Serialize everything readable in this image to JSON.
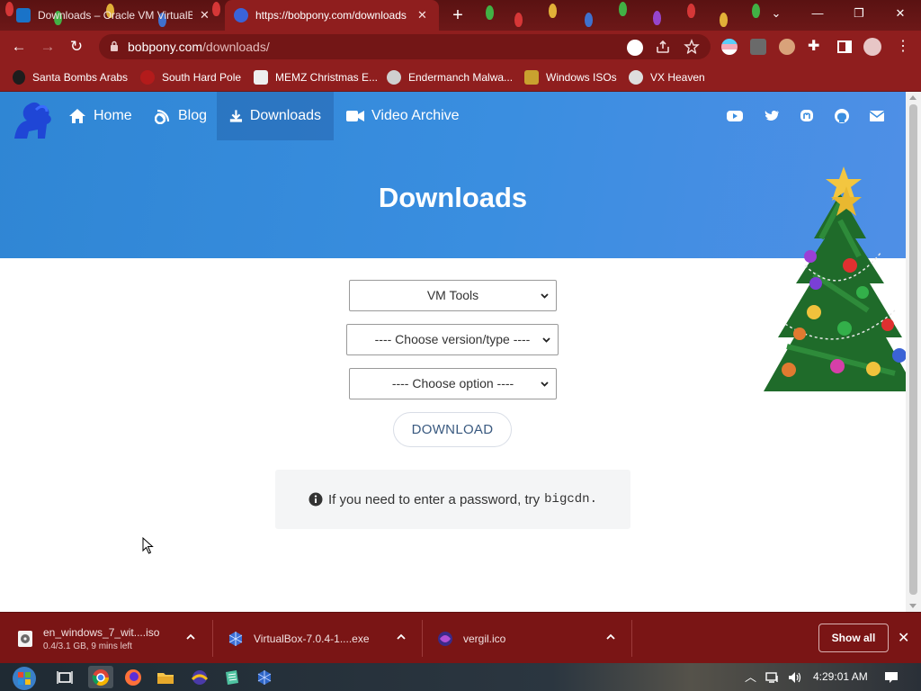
{
  "browser": {
    "tabs": [
      {
        "title": "Downloads – Oracle VM VirtualB",
        "active": false
      },
      {
        "title": "https://bobpony.com/downloads",
        "active": true
      }
    ],
    "url_host": "bobpony.com",
    "url_path": "/downloads/",
    "bookmarks": [
      {
        "label": "Santa Bombs Arabs"
      },
      {
        "label": "South Hard Pole"
      },
      {
        "label": "MEMZ Christmas E..."
      },
      {
        "label": "Endermanch Malwa..."
      },
      {
        "label": "Windows ISOs"
      },
      {
        "label": "VX Heaven"
      }
    ]
  },
  "site": {
    "nav": [
      {
        "label": "Home",
        "icon": "home-icon"
      },
      {
        "label": "Blog",
        "icon": "blog-icon"
      },
      {
        "label": "Downloads",
        "icon": "download-icon",
        "active": true
      },
      {
        "label": "Video Archive",
        "icon": "video-icon"
      }
    ],
    "social_icons": [
      "youtube-icon",
      "twitter-icon",
      "mastodon-icon",
      "github-icon",
      "email-icon"
    ],
    "page_title": "Downloads",
    "selects": {
      "category": "VM Tools",
      "version": "---- Choose version/type ----",
      "option": "---- Choose option ----"
    },
    "download_button": "DOWNLOAD",
    "note_text": "If you need to enter a password, try",
    "note_code": "bigcdn."
  },
  "downloads_shelf": {
    "items": [
      {
        "name": "en_windows_7_wit....iso",
        "status": "0.4/3.1 GB, 9 mins left"
      },
      {
        "name": "VirtualBox-7.0.4-1....exe",
        "status": ""
      },
      {
        "name": "vergil.ico",
        "status": ""
      }
    ],
    "show_all": "Show all"
  },
  "taskbar": {
    "clock": "4:29:01 AM"
  },
  "colors": {
    "chrome_dark": "#5a1212",
    "chrome": "#8f1e1e",
    "hero_blue": "#3a8ee0",
    "shelf": "#7a1515"
  }
}
